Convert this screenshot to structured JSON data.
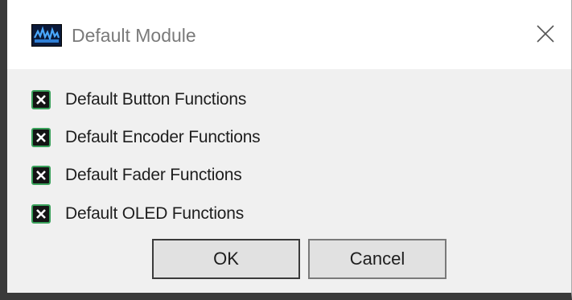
{
  "window": {
    "title": "Default Module",
    "icon": "app-logo-icon",
    "close_icon": "close-icon"
  },
  "options": [
    {
      "label": "Default Button Functions",
      "checked": true
    },
    {
      "label": "Default Encoder Functions",
      "checked": true
    },
    {
      "label": "Default Fader Functions",
      "checked": true
    },
    {
      "label": "Default OLED Functions",
      "checked": true
    }
  ],
  "buttons": {
    "ok_label": "OK",
    "cancel_label": "Cancel"
  },
  "colors": {
    "checkbox_fill": "#141414",
    "checkbox_border": "#39a05a",
    "title_text": "#7a7a7a"
  }
}
